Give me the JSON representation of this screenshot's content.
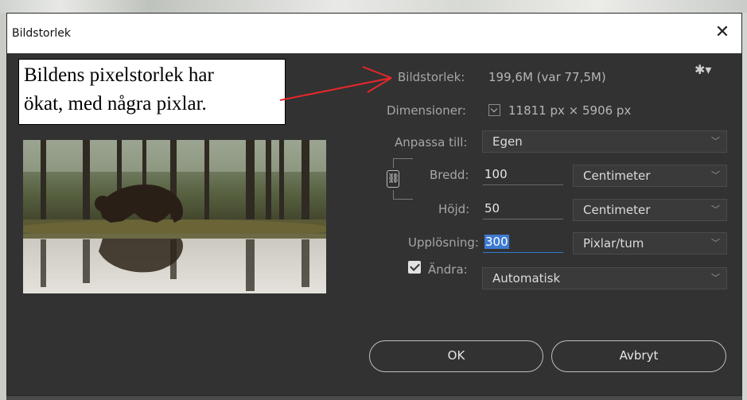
{
  "window": {
    "title": "Bildstorlek",
    "close_glyph": "✕"
  },
  "annotation": {
    "line1": "Bildens pixelstorlek har",
    "line2": "ökat, med några pixlar."
  },
  "image_size": {
    "label": "Bildstorlek:",
    "value": "199,6M (var 77,5M)"
  },
  "dimensions": {
    "label": "Dimensioner:",
    "value": "11811 px  ×  5906 px"
  },
  "fit_to": {
    "label": "Anpassa till:",
    "value": "Egen"
  },
  "width": {
    "label": "Bredd:",
    "value": "100",
    "unit": "Centimeter"
  },
  "height": {
    "label": "Höjd:",
    "value": "50",
    "unit": "Centimeter"
  },
  "resolution": {
    "label": "Upplösning:",
    "value": "300",
    "unit": "Pixlar/tum"
  },
  "resample": {
    "label": "Ändra:",
    "checked": true,
    "value": "Automatisk"
  },
  "buttons": {
    "ok": "OK",
    "cancel": "Avbryt"
  },
  "icons": {
    "settings": "gear-icon",
    "link": "chain-link-icon",
    "chevron": "chevron-down-icon",
    "close": "close-icon"
  },
  "colors": {
    "dialog_bg": "#323232",
    "label": "#a6a6a6",
    "accent": "#2e7ad6",
    "arrow": "#e8262b"
  }
}
